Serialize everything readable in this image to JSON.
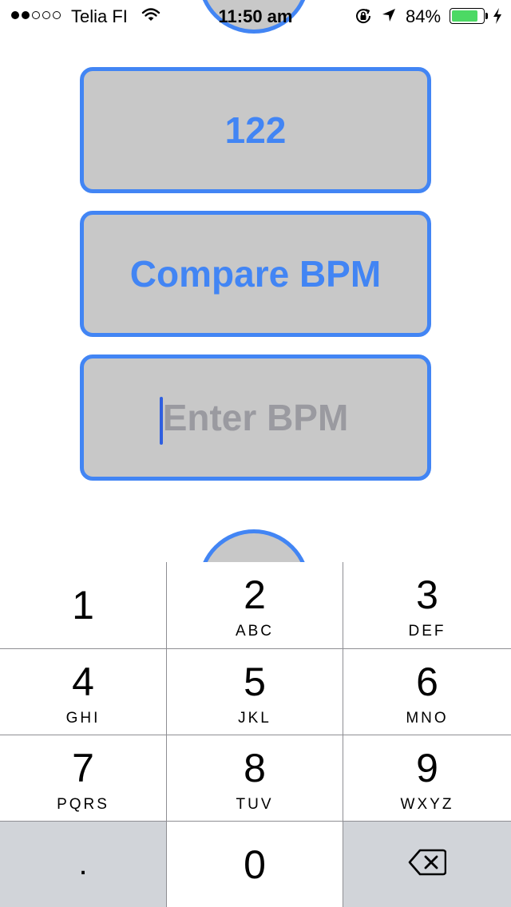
{
  "status_bar": {
    "carrier": "Telia FI",
    "time": "11:50 am",
    "battery": "84%",
    "battery_level": 0.84,
    "signal_bars": 2,
    "signal_total": 5,
    "icons": [
      "wifi-icon",
      "rotation-lock-icon",
      "location-arrow-icon",
      "battery-icon",
      "charging-icon"
    ]
  },
  "main": {
    "bpm_value": "122",
    "compare_label": "Compare BPM",
    "input_placeholder": "Enter BPM",
    "input_value": ""
  },
  "keypad": {
    "keys": [
      {
        "digit": "1",
        "letters": ""
      },
      {
        "digit": "2",
        "letters": "ABC"
      },
      {
        "digit": "3",
        "letters": "DEF"
      },
      {
        "digit": "4",
        "letters": "GHI"
      },
      {
        "digit": "5",
        "letters": "JKL"
      },
      {
        "digit": "6",
        "letters": "MNO"
      },
      {
        "digit": "7",
        "letters": "PQRS"
      },
      {
        "digit": "8",
        "letters": "TUV"
      },
      {
        "digit": "9",
        "letters": "WXYZ"
      },
      {
        "digit": ".",
        "letters": ""
      },
      {
        "digit": "0",
        "letters": ""
      }
    ],
    "backspace_icon": "backspace-icon"
  },
  "colors": {
    "accent": "#4285f4",
    "box_fill": "#c8c8c8",
    "placeholder": "#9a9aa0",
    "battery": "#4cd964",
    "key_dark": "#d1d4d9"
  }
}
